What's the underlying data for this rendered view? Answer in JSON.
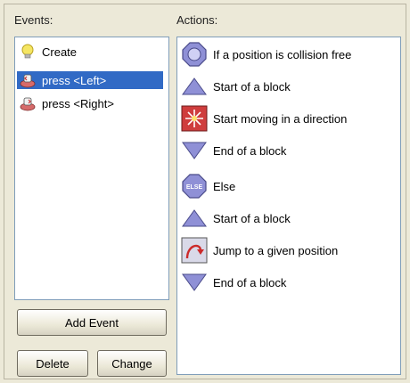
{
  "events_panel": {
    "label": "Events:",
    "items": [
      {
        "label": "Create",
        "icon": "lightbulb-icon",
        "selected": false
      },
      {
        "label": "press <Left>",
        "icon": "key-press-icon",
        "selected": true
      },
      {
        "label": "press <Right>",
        "icon": "key-press-icon",
        "selected": false
      }
    ]
  },
  "actions_panel": {
    "label": "Actions:",
    "items": [
      {
        "label": "If a position is collision free",
        "icon": "octagon-check-icon"
      },
      {
        "label": "Start of a block",
        "icon": "triangle-up-icon"
      },
      {
        "label": "Start moving in a direction",
        "icon": "move-directions-icon"
      },
      {
        "label": "End of a block",
        "icon": "triangle-down-icon"
      },
      {
        "label": "Else",
        "icon": "else-icon"
      },
      {
        "label": "Start of a block",
        "icon": "triangle-up-icon"
      },
      {
        "label": "Jump to a given position",
        "icon": "jump-arrow-icon"
      },
      {
        "label": "End of a block",
        "icon": "triangle-down-icon"
      }
    ]
  },
  "buttons": {
    "add_event": "Add Event",
    "delete": "Delete",
    "change": "Change"
  },
  "else_icon_text": "ELSE",
  "colors": {
    "selection": "#316ac5",
    "block_icon": "#8f90d6",
    "panel_bg": "#ece9d8"
  }
}
